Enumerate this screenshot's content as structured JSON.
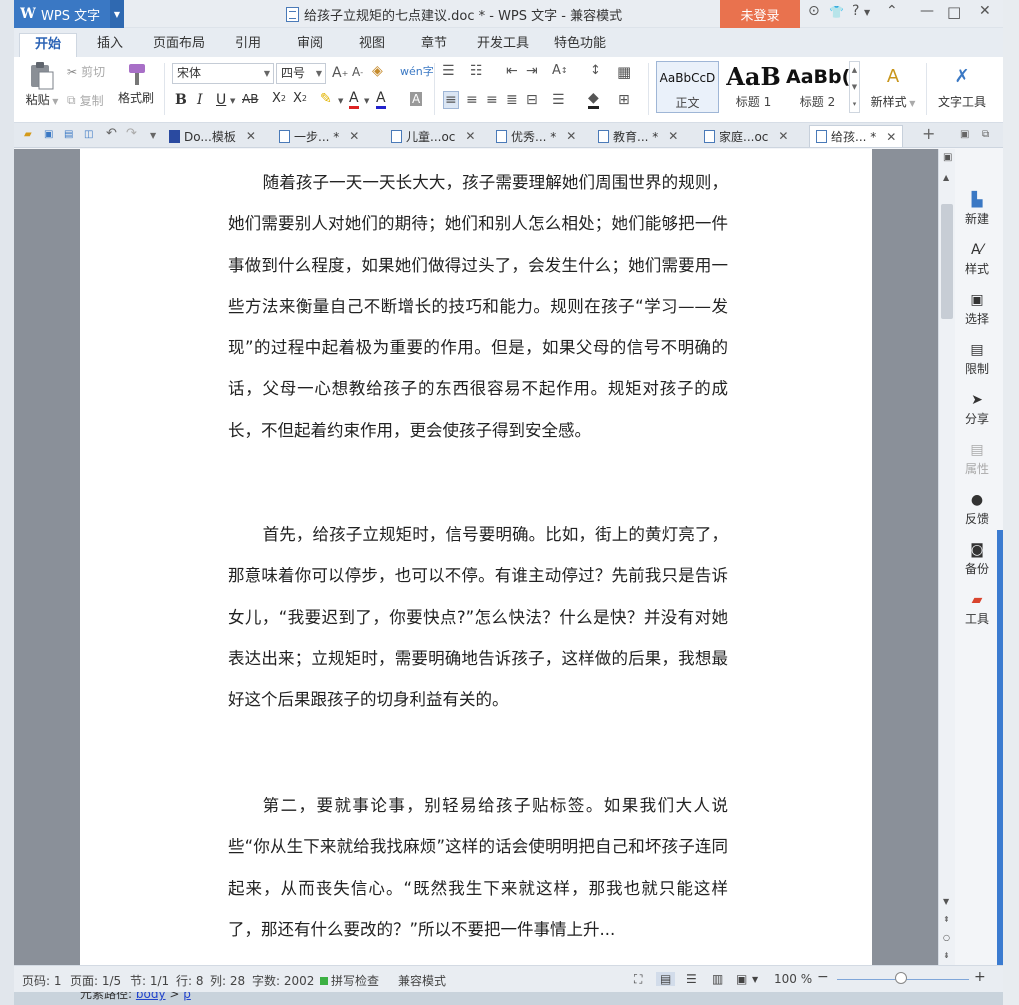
{
  "app": {
    "name": "WPS 文字",
    "title": "给孩子立规矩的七点建议.doc * - WPS 文字 - 兼容模式",
    "login": "未登录"
  },
  "window_controls": {
    "skin": "⊙",
    "shirt": "👕",
    "help": "?",
    "collapse": "⌃",
    "minimize": "—",
    "maximize": "□",
    "close": "✕"
  },
  "menu_tabs": [
    "开始",
    "插入",
    "页面布局",
    "引用",
    "审阅",
    "视图",
    "章节",
    "开发工具",
    "特色功能"
  ],
  "ribbon": {
    "paste": "粘贴",
    "cut": "剪切",
    "copy": "复制",
    "format_painter": "格式刷",
    "font_name": "宋体",
    "font_size": "四号",
    "styles": [
      {
        "sample": "AaBbCcD",
        "label": "正文"
      },
      {
        "sample": "AaB",
        "label": "标题 1"
      },
      {
        "sample": "AaBb(",
        "label": "标题 2"
      }
    ],
    "new_style": "新样式",
    "text_tools": "文字工具"
  },
  "doc_tabs": [
    {
      "label": "Do...模板",
      "active": false
    },
    {
      "label": "一步... *",
      "active": false
    },
    {
      "label": "儿童...oc",
      "active": false
    },
    {
      "label": "优秀... *",
      "active": false
    },
    {
      "label": "教育... *",
      "active": false
    },
    {
      "label": "家庭...oc",
      "active": false
    },
    {
      "label": "给孩... *",
      "active": true
    }
  ],
  "document": {
    "paragraphs": [
      "随着孩子一天一天长大大，孩子需要理解她们周围世界的规则，她们需要别人对她们的期待；她们和别人怎么相处；她们能够把一件事做到什么程度，如果她们做得过头了，会发生什么；她们需要用一些方法来衡量自己不断增长的技巧和能力。规则在孩子“学习——发现”的过程中起着极为重要的作用。但是，如果父母的信号不明确的话，父母一心想教给孩子的东西很容易不起作用。规矩对孩子的成长，不但起着约束作用，更会使孩子得到安全感。",
      "首先，给孩子立规矩时，信号要明确。比如，街上的黄灯亮了，那意味着你可以停步，也可以不停。有谁主动停过？先前我只是告诉女儿，“我要迟到了，你要快点?”怎么快法？什么是快？并没有对她表达出来；立规矩时，需要明确地告诉孩子，这样做的后果，我想最好这个后果跟孩子的切身利益有关的。",
      "第二，要就事论事，别轻易给孩子贴标签。如果我们大人说些“你从生下来就给我找麻烦”这样的话会使明明把自己和坏孩子连同起来，从而丧失信心。“既然我生下来就这样，那我也就只能这样了，那还有什么要改的？”所以不要把一件事情上升..."
    ]
  },
  "right_panel": [
    {
      "label": "新建",
      "icon": "new-icon",
      "enabled": true
    },
    {
      "label": "样式",
      "icon": "style-icon",
      "enabled": true
    },
    {
      "label": "选择",
      "icon": "select-icon",
      "enabled": true
    },
    {
      "label": "限制",
      "icon": "restrict-icon",
      "enabled": true
    },
    {
      "label": "分享",
      "icon": "share-icon",
      "enabled": true
    },
    {
      "label": "属性",
      "icon": "properties-icon",
      "enabled": false
    },
    {
      "label": "反馈",
      "icon": "feedback-icon",
      "enabled": true
    },
    {
      "label": "备份",
      "icon": "backup-icon",
      "enabled": true
    },
    {
      "label": "工具",
      "icon": "tools-icon",
      "enabled": true
    }
  ],
  "status": {
    "page_num": "页码: 1",
    "pages": "页面: 1/5",
    "section": "节: 1/1",
    "row": "行: 8",
    "col": "列: 28",
    "word_count": "字数: 2002",
    "spellcheck": "拼写检查",
    "compat": "兼容模式",
    "zoom": "100 %"
  },
  "background": {
    "element_path": "元素路径:",
    "body_link": "body",
    "p_link": "p"
  },
  "colors": {
    "accent": "#3a78c4",
    "login": "#e9724e",
    "active_tab": "#2b63b5"
  }
}
